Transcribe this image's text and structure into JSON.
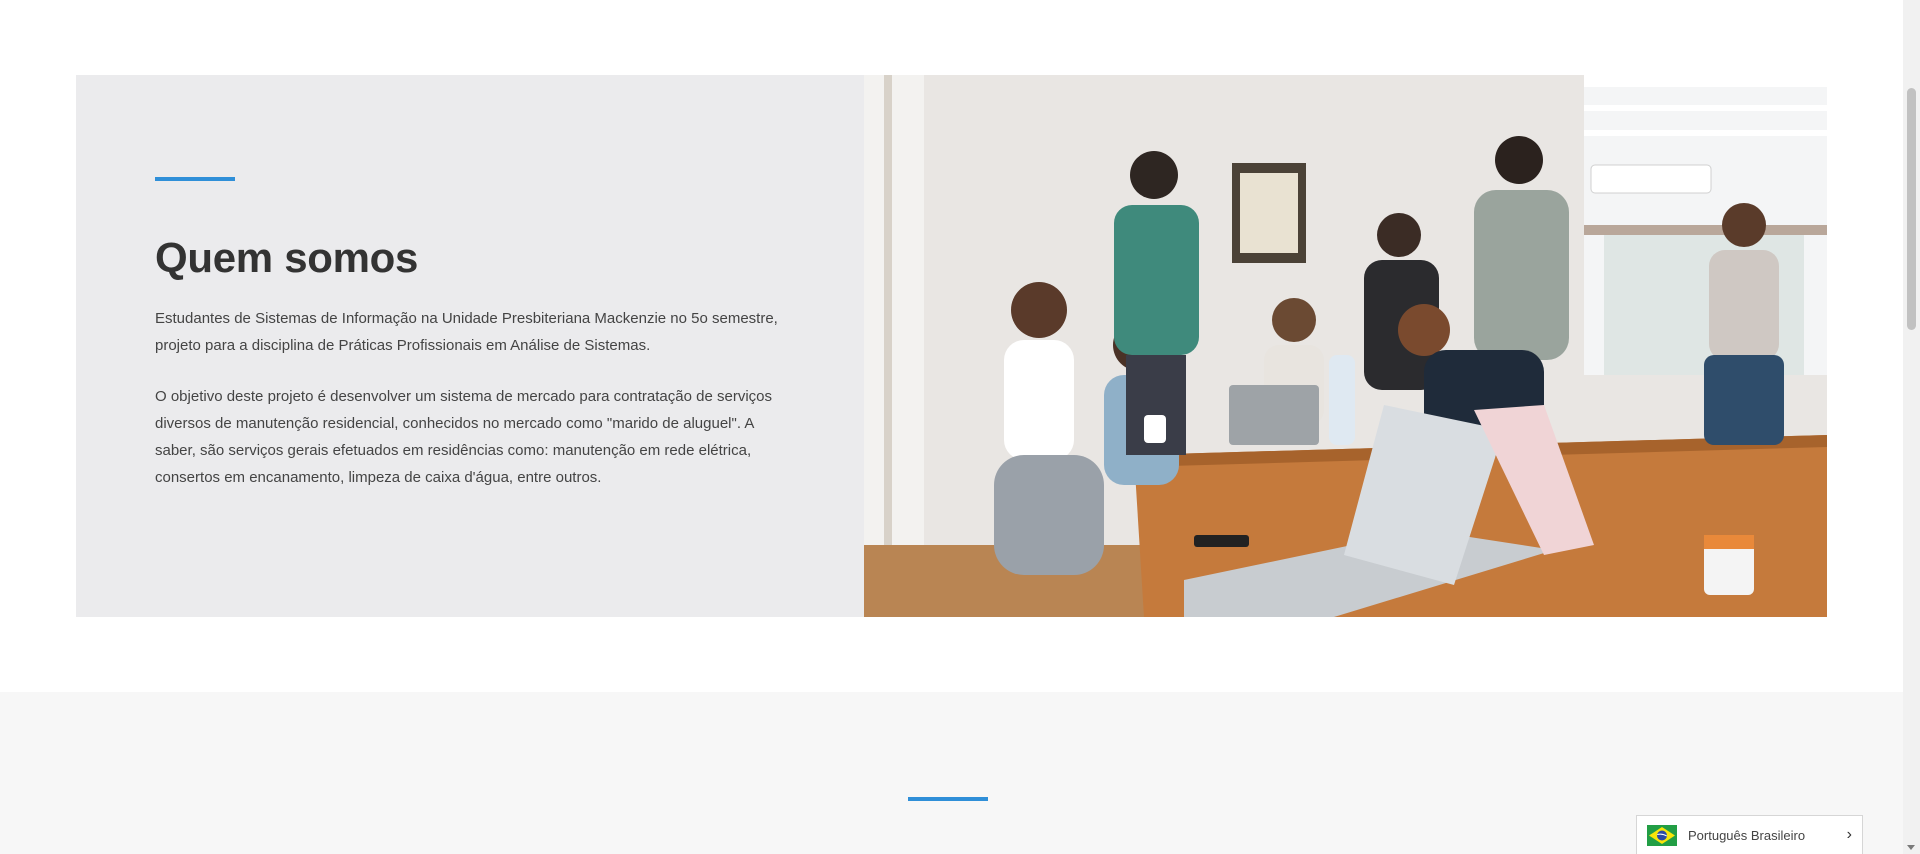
{
  "about": {
    "title": "Quem somos",
    "paragraph1": "Estudantes de Sistemas de Informação na Unidade Presbiteriana Mackenzie no 5o semestre, projeto para a disciplina de Práticas Profissionais em Análise de Sistemas.",
    "paragraph2": "O objetivo deste projeto é desenvolver um sistema de mercado para contratação de serviços diversos de manutenção residencial, conhecidos no mercado como \"marido de aluguel\". A saber, são serviços gerais efetuados em residências como: manutenção em rede elétrica, consertos em encanamento, limpeza de caixa d'água, entre outros.",
    "image_icon": "team-photo"
  },
  "language_switcher": {
    "label": "Português Brasileiro",
    "flag_icon": "brazil-flag-icon",
    "chevron_icon": "chevron-right-icon"
  },
  "colors": {
    "accent": "#2f8fd8",
    "panel_bg": "#ebebed",
    "section_bg": "#f7f7f7"
  }
}
